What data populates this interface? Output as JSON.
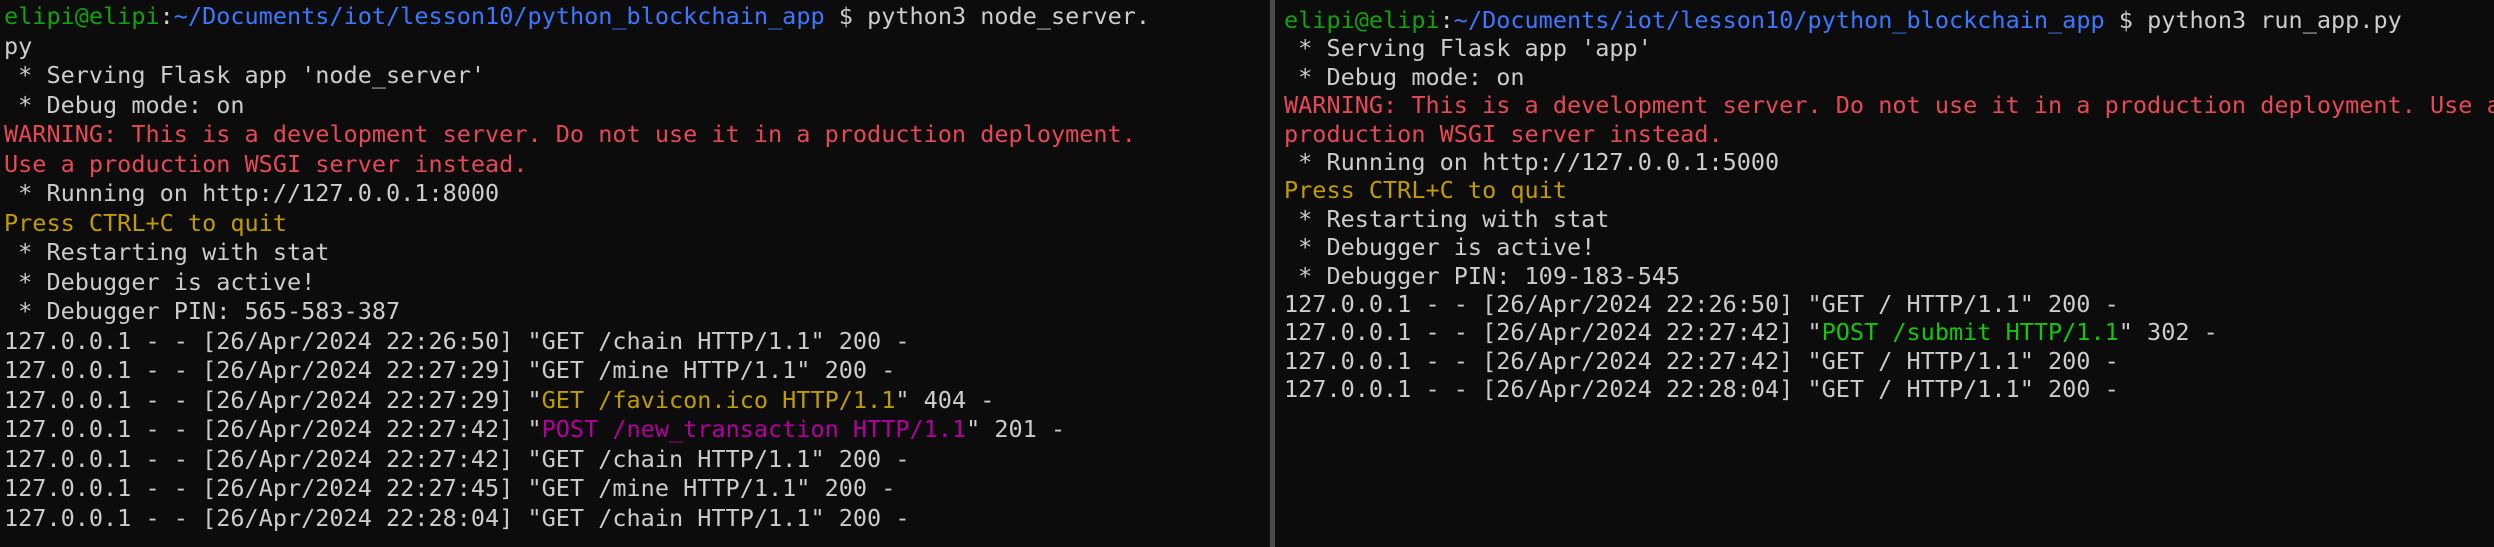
{
  "colors": {
    "background": "#0c0c0c",
    "default_text": "#cccccc",
    "prompt_user": "#13a10e",
    "prompt_path": "#3b78ff",
    "warning": "#e74856",
    "hint": "#c19c00",
    "post_left": "#b4009e",
    "post_right": "#16c60c",
    "divider": "#4a4a4a"
  },
  "left": {
    "prompt_user": "elipi@elipi",
    "prompt_sep": ":",
    "prompt_path": "~/Documents/iot/lesson10/python_blockchain_app",
    "prompt_symbol": " $ ",
    "command": "python3 node_server.",
    "command_wrap": "py",
    "serving": " * Serving Flask app 'node_server'",
    "debug_mode": " * Debug mode: on",
    "warning_1": "WARNING: This is a development server. Do not use it in a production deployment.",
    "warning_2": "Use a production WSGI server instead.",
    "running": " * Running on http://127.0.0.1:8000",
    "press": "Press CTRL+C to quit",
    "restarting": " * Restarting with stat",
    "debugger_active": " * Debugger is active!",
    "debugger_pin": " * Debugger PIN: 565-583-387",
    "log": [
      {
        "prefix": "127.0.0.1 - - [26/Apr/2024 22:26:50] \"GET /chain HTTP/1.1\" 200 -"
      },
      {
        "prefix": "127.0.0.1 - - [26/Apr/2024 22:27:29] \"GET /mine HTTP/1.1\" 200 -"
      },
      {
        "prefix": "127.0.0.1 - - [26/Apr/2024 22:27:29] \"",
        "request": "GET /favicon.ico HTTP/1.1",
        "suffix": "\" 404 -"
      },
      {
        "prefix": "127.0.0.1 - - [26/Apr/2024 22:27:42] \"",
        "request": "POST /new_transaction HTTP/1.1",
        "suffix": "\" 201 -"
      },
      {
        "prefix": "127.0.0.1 - - [26/Apr/2024 22:27:42] \"GET /chain HTTP/1.1\" 200 -"
      },
      {
        "prefix": "127.0.0.1 - - [26/Apr/2024 22:27:45] \"GET /mine HTTP/1.1\" 200 -"
      },
      {
        "prefix": "127.0.0.1 - - [26/Apr/2024 22:28:04] \"GET /chain HTTP/1.1\" 200 -"
      }
    ]
  },
  "right": {
    "prompt_user": "elipi@elipi",
    "prompt_sep": ":",
    "prompt_path": "~/Documents/iot/lesson10/python_blockchain_app",
    "prompt_symbol": " $ ",
    "command": "python3 run_app.py",
    "serving": " * Serving Flask app 'app'",
    "debug_mode": " * Debug mode: on",
    "warning_1": "WARNING: This is a development server. Do not use it in a production deployment. Use a",
    "warning_2": "production WSGI server instead.",
    "running": " * Running on http://127.0.0.1:5000",
    "press": "Press CTRL+C to quit",
    "restarting": " * Restarting with stat",
    "debugger_active": " * Debugger is active!",
    "debugger_pin": " * Debugger PIN: 109-183-545",
    "log": [
      {
        "prefix": "127.0.0.1 - - [26/Apr/2024 22:26:50] \"GET / HTTP/1.1\" 200 -"
      },
      {
        "prefix": "127.0.0.1 - - [26/Apr/2024 22:27:42] \"",
        "request": "POST /submit HTTP/1.1",
        "suffix": "\" 302 -"
      },
      {
        "prefix": "127.0.0.1 - - [26/Apr/2024 22:27:42] \"GET / HTTP/1.1\" 200 -"
      },
      {
        "prefix": "127.0.0.1 - - [26/Apr/2024 22:28:04] \"GET / HTTP/1.1\" 200 -"
      }
    ]
  }
}
